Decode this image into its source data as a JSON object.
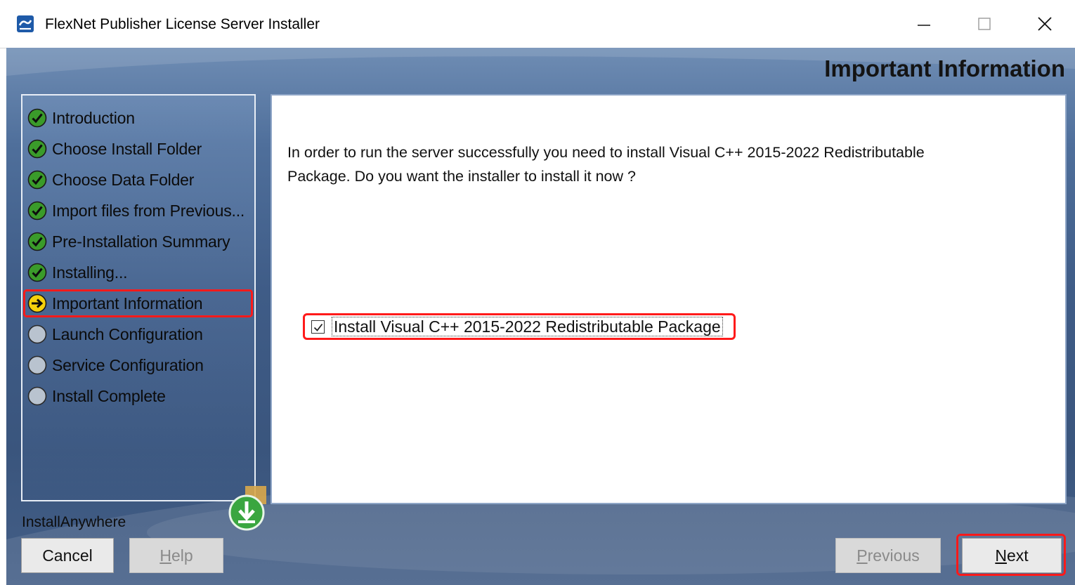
{
  "window": {
    "title": "FlexNet Publisher License Server Installer",
    "icons": {
      "app": "installer-app-icon",
      "minimize": "minimize-icon",
      "maximize": "maximize-icon",
      "close": "close-icon"
    }
  },
  "header": {
    "title": "Important Information"
  },
  "steps": [
    {
      "label": "Introduction",
      "status": "done",
      "icon": "check-circle-icon"
    },
    {
      "label": "Choose Install Folder",
      "status": "done",
      "icon": "check-circle-icon"
    },
    {
      "label": "Choose Data Folder",
      "status": "done",
      "icon": "check-circle-icon"
    },
    {
      "label": "Import files from Previous...",
      "status": "done",
      "icon": "check-circle-icon"
    },
    {
      "label": "Pre-Installation Summary",
      "status": "done",
      "icon": "check-circle-icon"
    },
    {
      "label": "Installing...",
      "status": "done",
      "icon": "check-circle-icon"
    },
    {
      "label": "Important Information",
      "status": "current",
      "icon": "arrow-circle-icon"
    },
    {
      "label": "Launch Configuration",
      "status": "pending",
      "icon": "empty-circle-icon"
    },
    {
      "label": "Service Configuration",
      "status": "pending",
      "icon": "empty-circle-icon"
    },
    {
      "label": "Install Complete",
      "status": "pending",
      "icon": "empty-circle-icon"
    }
  ],
  "content": {
    "message_line1": "In order to run the server successfully you need to install Visual C++ 2015-2022 Redistributable",
    "message_line2": "Package. Do you want the installer to install it now ?",
    "checkbox": {
      "label": "Install Visual C++ 2015-2022 Redistributable Package",
      "checked": true
    }
  },
  "footer": {
    "brand": "InstallAnywhere",
    "buttons": {
      "cancel": {
        "label": "Cancel",
        "enabled": true
      },
      "help": {
        "mnemonic": "H",
        "rest": "elp",
        "enabled": false
      },
      "previous": {
        "mnemonic": "P",
        "rest": "revious",
        "enabled": false
      },
      "next": {
        "mnemonic": "N",
        "rest": "ext",
        "enabled": true
      }
    }
  },
  "colors": {
    "highlight": "#ff1a1a",
    "frame_blue": "#4f6f9b",
    "check_green": "#3a9b2a",
    "current_yellow": "#f5d10c"
  }
}
